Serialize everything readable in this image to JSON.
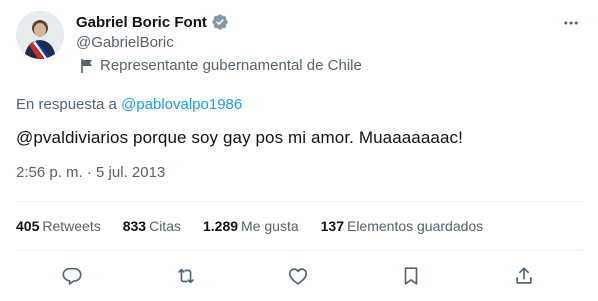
{
  "author": {
    "name": "Gabriel Boric Font",
    "handle": "@GabrielBoric",
    "affiliation": "Representante gubernamental de Chile"
  },
  "reply": {
    "prefix": "En respuesta a",
    "mention": "@pablovalpo1986"
  },
  "tweet": {
    "text": "@pvaldiviarios porque soy gay pos mi amor. Muaaaaaaac!",
    "timestamp": "2:56 p. m. · 5 jul. 2013"
  },
  "stats": [
    {
      "value": "405",
      "label": "Retweets"
    },
    {
      "value": "833",
      "label": "Citas"
    },
    {
      "value": "1.289",
      "label": "Me gusta"
    },
    {
      "value": "137",
      "label": "Elementos guardados"
    }
  ],
  "icons": {
    "verified": "verified-badge-icon",
    "affiliation": "flag-icon",
    "more": "more-icon",
    "reply": "reply-icon",
    "retweet": "retweet-icon",
    "like": "heart-icon",
    "bookmark": "bookmark-icon",
    "share": "share-icon"
  },
  "colors": {
    "accent": "#1d9bf0",
    "text": "#0f1419",
    "secondary": "#536471",
    "verified_badge": "#829aab"
  }
}
